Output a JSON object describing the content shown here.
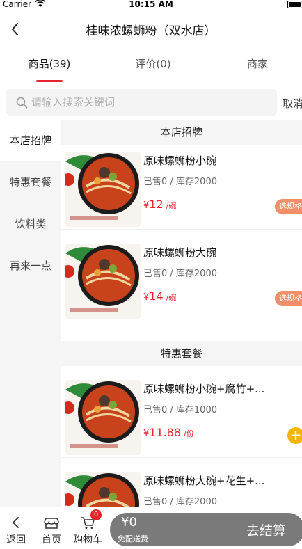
{
  "status_bar": {
    "carrier": "Carrier",
    "time": "10:15 AM"
  },
  "nav": {
    "title": "桂味浓螺蛳粉（双水店）"
  },
  "tabs": [
    {
      "label": "商品(39)"
    },
    {
      "label": "评价(0)"
    },
    {
      "label": "商家"
    }
  ],
  "search": {
    "placeholder": "请输入搜索关键词",
    "value": "",
    "cancel_label": "取消"
  },
  "sidebar": {
    "items": [
      {
        "label": "本店招牌",
        "active": true
      },
      {
        "label": "特惠套餐"
      },
      {
        "label": "饮料类"
      },
      {
        "label": "再来一点"
      }
    ]
  },
  "sections": [
    {
      "title": "本店招牌",
      "products": [
        {
          "name": "原味螺蛳粉小碗",
          "stock": "已售0 / 库存2000",
          "currency": "¥",
          "price": "12",
          "unit": "/碗",
          "action": "选规格"
        },
        {
          "name": "原味螺蛳粉大碗",
          "stock": "已售0 / 库存2000",
          "currency": "¥",
          "price": "14",
          "unit": "/碗",
          "action": "选规格"
        }
      ]
    },
    {
      "title": "特惠套餐",
      "products": [
        {
          "name": "原味螺蛳粉小碗+腐竹+...",
          "stock": "已售0 / 库存1000",
          "currency": "¥",
          "price": "11.88",
          "unit": "/份",
          "action": "+"
        },
        {
          "name": "原味螺蛳粉大碗+花生+...",
          "stock": "已售0 / 库存2000"
        }
      ]
    }
  ],
  "bottom_bar": {
    "back_label": "返回",
    "home_label": "首页",
    "cart_label": "购物车",
    "cart_count": "0",
    "amount": "¥0",
    "delivery_note": "免配送费",
    "checkout_label": "去结算"
  },
  "colors": {
    "accent": "#e3262e",
    "spec_button": "#f28f6b",
    "add_button": "#f5b400",
    "checkout_bg": "#7a7a7a"
  }
}
